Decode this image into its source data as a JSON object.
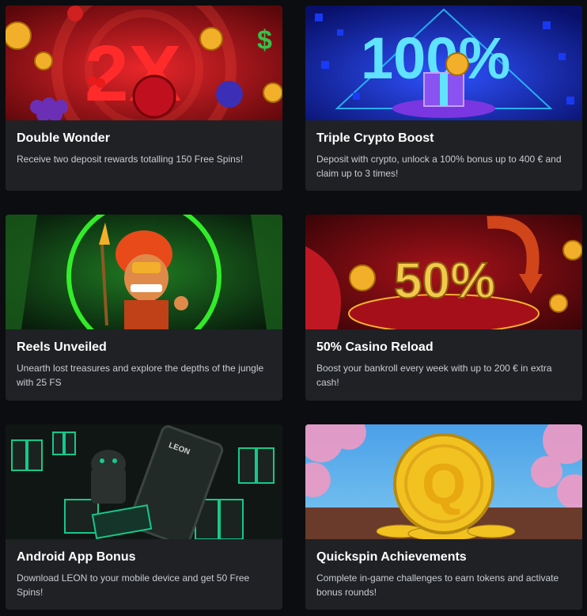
{
  "promotions": [
    {
      "title": "Double Wonder",
      "description": "Receive two deposit rewards totalling 150 Free Spins!",
      "banner_text": "2X",
      "colors": {
        "base": "#b3121a",
        "accent": "#e8262a"
      }
    },
    {
      "title": "Triple Crypto Boost",
      "description": "Deposit with crypto, unlock a 100% bonus up to 400 € and claim up to 3 times!",
      "banner_text": "100%",
      "colors": {
        "base": "#0d1fb8",
        "accent": "#2bd0ff"
      }
    },
    {
      "title": "Reels Unveiled",
      "description": "Unearth lost treasures and explore the depths of the jungle with 25 FS",
      "banner_text": "",
      "colors": {
        "base": "#0e3d12",
        "accent": "#36ff2b"
      }
    },
    {
      "title": "50% Casino Reload",
      "description": "Boost your bankroll every week with up to 200 € in extra cash!",
      "banner_text": "50%",
      "colors": {
        "base": "#6a0b0f",
        "accent": "#f2b02a"
      }
    },
    {
      "title": "Android App Bonus",
      "description": "Download LEON to your mobile device and get 50 Free Spins!",
      "banner_text": "LEON",
      "colors": {
        "base": "#0f1512",
        "accent": "#15c98a"
      }
    },
    {
      "title": "Quickspin Achievements",
      "description": "Complete in-game challenges to earn tokens and activate bonus rounds!",
      "banner_text": "Q",
      "colors": {
        "base": "#3f8fd8",
        "accent": "#f2c221"
      }
    }
  ]
}
